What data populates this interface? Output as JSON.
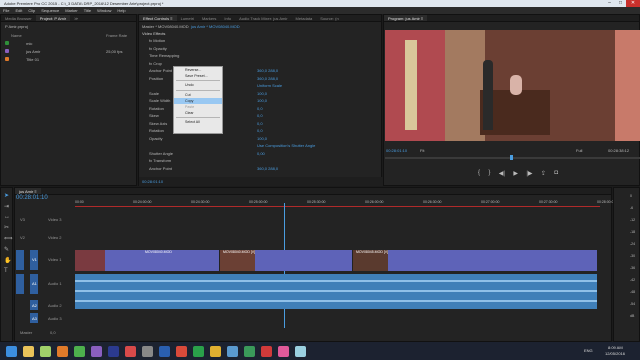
{
  "window": {
    "title": "Adobe Premiere Pro CC 2015 - C:\\_3 DATA\\ DRP_2016\\12 Desember Arie\\project.prproj *",
    "controls": [
      "–",
      "□",
      "✕"
    ]
  },
  "menu": [
    "File",
    "Edit",
    "Clip",
    "Sequence",
    "Marker",
    "Title",
    "Window",
    "Help"
  ],
  "project_panel": {
    "tabs": [
      "Media Browser",
      "Project: P Amir",
      "≫"
    ],
    "subtitle": "P Amir.prproj",
    "col_name": "Name",
    "col_rate": "Frame Rate",
    "items": [
      {
        "name": "mic",
        "rate": "",
        "color": "#2f8f3a"
      },
      {
        "name": "jus Amir",
        "rate": "25,00 fps",
        "color": "#8a5fbf"
      },
      {
        "name": "Title 01",
        "rate": "",
        "color": "#e07a2a"
      }
    ]
  },
  "effect_controls": {
    "tabs": [
      "Effect Controls ≡",
      "Lumetri",
      "Markers",
      "Info",
      "Audio Track Mixer: jus Amir",
      "Metadata",
      "Source: (n",
      "≫"
    ],
    "master": "Master * MOV08040.MOD",
    "clip": "jus Amir * MOV08040.MOD",
    "section": "Video Effects",
    "rows": [
      {
        "name": "fx Motion",
        "value": ""
      },
      {
        "name": "fx Opacity",
        "value": ""
      },
      {
        "name": "Time Remapping",
        "value": ""
      },
      {
        "name": "fx Crop",
        "value": ""
      },
      {
        "name": "Anchor Point",
        "value": "360,0   288,0"
      },
      {
        "name": "Position",
        "value": "360,0   288,0"
      },
      {
        "name": "",
        "value": "Uniform Scale"
      },
      {
        "name": "Scale",
        "value": "100,0"
      },
      {
        "name": "Scale Width",
        "value": "100,0"
      },
      {
        "name": "Rotation",
        "value": "0,0"
      },
      {
        "name": "Skew",
        "value": "0,0"
      },
      {
        "name": "Skew Axis",
        "value": "0,0"
      },
      {
        "name": "Rotation",
        "value": "0,0"
      },
      {
        "name": "Opacity",
        "value": "100,0"
      },
      {
        "name": "",
        "value": "Use Composition's Shutter Angle"
      },
      {
        "name": "Shutter Angle",
        "value": "0,00"
      },
      {
        "name": "fx Transform",
        "value": ""
      },
      {
        "name": "Anchor Point",
        "value": "360,0   288,0"
      }
    ],
    "timecode": "00:28:01:10"
  },
  "context_menu": {
    "items": [
      "Reverse...",
      "Save Preset...",
      "Undo",
      "Cut",
      "Copy",
      "Paste",
      "Clear",
      "Select All"
    ],
    "highlighted": "Copy",
    "disabled": [
      "Paste"
    ]
  },
  "program_monitor": {
    "title": "Program: jus Amir ≡",
    "timecode_left": "00:28:01:10",
    "fit": "Fit",
    "quality": "Full",
    "timecode_right": "00:28:38:12"
  },
  "timeline": {
    "tab": "jus Amir ≡",
    "timecode": "00:28:01:10",
    "ruler": [
      "00:00",
      "00:24:00:00",
      "00:24:30:00",
      "00:25:00:00",
      "00:25:30:00",
      "00:26:00:00",
      "00:26:30:00",
      "00:27:00:00",
      "00:27:30:00",
      "00:28:00:00"
    ],
    "tracks": {
      "video": [
        "V3",
        "V2",
        "V1"
      ],
      "video_names": [
        "Video 3",
        "Video 2",
        "Video 1"
      ],
      "audio": [
        "A1",
        "A2",
        "A3",
        "Master"
      ],
      "audio_names": [
        "Audio 1",
        "Audio 2",
        "Audio 3",
        "Master"
      ],
      "master_val": "0,0"
    },
    "clips": [
      {
        "label": "MOV08040.MOD"
      },
      {
        "label": "MOV08040.MOD [V]"
      },
      {
        "label": "MOV08045.MOD [V]"
      }
    ]
  },
  "audio_meter": {
    "labels": [
      "0",
      "-6",
      "-12",
      "-18",
      "-24",
      "-30",
      "-36",
      "-42",
      "-48",
      "-54",
      "dB"
    ]
  },
  "taskbar": {
    "time": "8:09 AM",
    "date": "12/05/2016",
    "lang": "ENG"
  }
}
